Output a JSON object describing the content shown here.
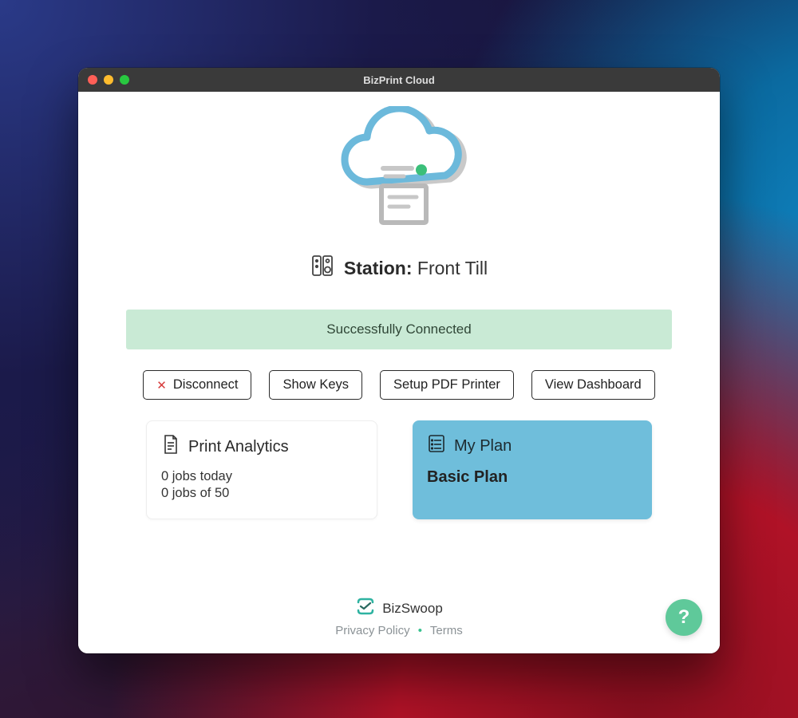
{
  "window": {
    "title": "BizPrint Cloud"
  },
  "station": {
    "label": "Station:",
    "name": "Front Till"
  },
  "status_banner": "Successfully Connected",
  "buttons": {
    "disconnect": "Disconnect",
    "show_keys": "Show Keys",
    "setup_pdf": "Setup PDF Printer",
    "view_dashboard": "View Dashboard"
  },
  "analytics": {
    "title": "Print Analytics",
    "line1": "0 jobs today",
    "line2": "0 jobs of 50"
  },
  "plan": {
    "title": "My Plan",
    "name": "Basic Plan"
  },
  "brand": "BizSwoop",
  "footer": {
    "privacy": "Privacy Policy",
    "terms": "Terms"
  },
  "help_label": "?",
  "colors": {
    "accent_green": "#5fc99a",
    "banner_bg": "#c9ead5",
    "plan_bg": "#6fbedb"
  }
}
